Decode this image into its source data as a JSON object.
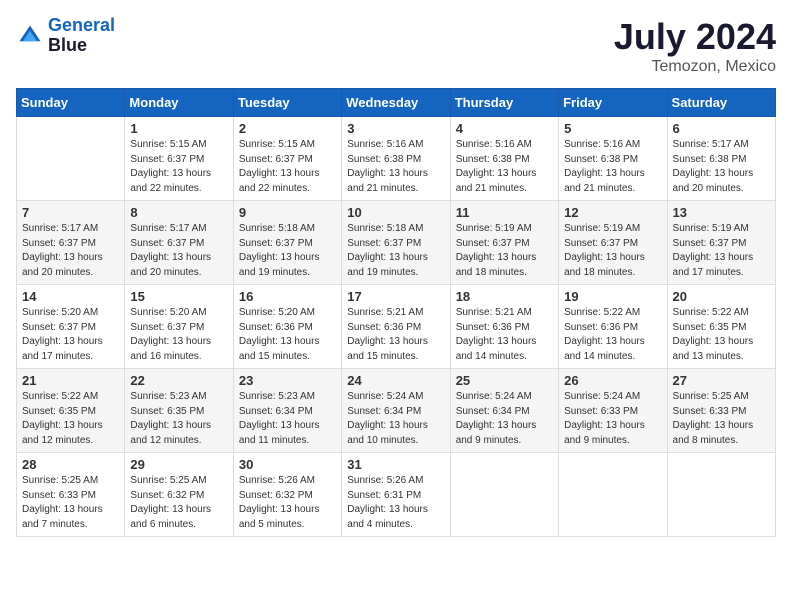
{
  "header": {
    "logo_line1": "General",
    "logo_line2": "Blue",
    "main_title": "July 2024",
    "subtitle": "Temozon, Mexico"
  },
  "weekdays": [
    "Sunday",
    "Monday",
    "Tuesday",
    "Wednesday",
    "Thursday",
    "Friday",
    "Saturday"
  ],
  "weeks": [
    [
      {
        "day": "",
        "sunrise": "",
        "sunset": "",
        "daylight": ""
      },
      {
        "day": "1",
        "sunrise": "Sunrise: 5:15 AM",
        "sunset": "Sunset: 6:37 PM",
        "daylight": "Daylight: 13 hours and 22 minutes."
      },
      {
        "day": "2",
        "sunrise": "Sunrise: 5:15 AM",
        "sunset": "Sunset: 6:37 PM",
        "daylight": "Daylight: 13 hours and 22 minutes."
      },
      {
        "day": "3",
        "sunrise": "Sunrise: 5:16 AM",
        "sunset": "Sunset: 6:38 PM",
        "daylight": "Daylight: 13 hours and 21 minutes."
      },
      {
        "day": "4",
        "sunrise": "Sunrise: 5:16 AM",
        "sunset": "Sunset: 6:38 PM",
        "daylight": "Daylight: 13 hours and 21 minutes."
      },
      {
        "day": "5",
        "sunrise": "Sunrise: 5:16 AM",
        "sunset": "Sunset: 6:38 PM",
        "daylight": "Daylight: 13 hours and 21 minutes."
      },
      {
        "day": "6",
        "sunrise": "Sunrise: 5:17 AM",
        "sunset": "Sunset: 6:38 PM",
        "daylight": "Daylight: 13 hours and 20 minutes."
      }
    ],
    [
      {
        "day": "7",
        "sunrise": "Sunrise: 5:17 AM",
        "sunset": "Sunset: 6:37 PM",
        "daylight": "Daylight: 13 hours and 20 minutes."
      },
      {
        "day": "8",
        "sunrise": "Sunrise: 5:17 AM",
        "sunset": "Sunset: 6:37 PM",
        "daylight": "Daylight: 13 hours and 20 minutes."
      },
      {
        "day": "9",
        "sunrise": "Sunrise: 5:18 AM",
        "sunset": "Sunset: 6:37 PM",
        "daylight": "Daylight: 13 hours and 19 minutes."
      },
      {
        "day": "10",
        "sunrise": "Sunrise: 5:18 AM",
        "sunset": "Sunset: 6:37 PM",
        "daylight": "Daylight: 13 hours and 19 minutes."
      },
      {
        "day": "11",
        "sunrise": "Sunrise: 5:19 AM",
        "sunset": "Sunset: 6:37 PM",
        "daylight": "Daylight: 13 hours and 18 minutes."
      },
      {
        "day": "12",
        "sunrise": "Sunrise: 5:19 AM",
        "sunset": "Sunset: 6:37 PM",
        "daylight": "Daylight: 13 hours and 18 minutes."
      },
      {
        "day": "13",
        "sunrise": "Sunrise: 5:19 AM",
        "sunset": "Sunset: 6:37 PM",
        "daylight": "Daylight: 13 hours and 17 minutes."
      }
    ],
    [
      {
        "day": "14",
        "sunrise": "Sunrise: 5:20 AM",
        "sunset": "Sunset: 6:37 PM",
        "daylight": "Daylight: 13 hours and 17 minutes."
      },
      {
        "day": "15",
        "sunrise": "Sunrise: 5:20 AM",
        "sunset": "Sunset: 6:37 PM",
        "daylight": "Daylight: 13 hours and 16 minutes."
      },
      {
        "day": "16",
        "sunrise": "Sunrise: 5:20 AM",
        "sunset": "Sunset: 6:36 PM",
        "daylight": "Daylight: 13 hours and 15 minutes."
      },
      {
        "day": "17",
        "sunrise": "Sunrise: 5:21 AM",
        "sunset": "Sunset: 6:36 PM",
        "daylight": "Daylight: 13 hours and 15 minutes."
      },
      {
        "day": "18",
        "sunrise": "Sunrise: 5:21 AM",
        "sunset": "Sunset: 6:36 PM",
        "daylight": "Daylight: 13 hours and 14 minutes."
      },
      {
        "day": "19",
        "sunrise": "Sunrise: 5:22 AM",
        "sunset": "Sunset: 6:36 PM",
        "daylight": "Daylight: 13 hours and 14 minutes."
      },
      {
        "day": "20",
        "sunrise": "Sunrise: 5:22 AM",
        "sunset": "Sunset: 6:35 PM",
        "daylight": "Daylight: 13 hours and 13 minutes."
      }
    ],
    [
      {
        "day": "21",
        "sunrise": "Sunrise: 5:22 AM",
        "sunset": "Sunset: 6:35 PM",
        "daylight": "Daylight: 13 hours and 12 minutes."
      },
      {
        "day": "22",
        "sunrise": "Sunrise: 5:23 AM",
        "sunset": "Sunset: 6:35 PM",
        "daylight": "Daylight: 13 hours and 12 minutes."
      },
      {
        "day": "23",
        "sunrise": "Sunrise: 5:23 AM",
        "sunset": "Sunset: 6:34 PM",
        "daylight": "Daylight: 13 hours and 11 minutes."
      },
      {
        "day": "24",
        "sunrise": "Sunrise: 5:24 AM",
        "sunset": "Sunset: 6:34 PM",
        "daylight": "Daylight: 13 hours and 10 minutes."
      },
      {
        "day": "25",
        "sunrise": "Sunrise: 5:24 AM",
        "sunset": "Sunset: 6:34 PM",
        "daylight": "Daylight: 13 hours and 9 minutes."
      },
      {
        "day": "26",
        "sunrise": "Sunrise: 5:24 AM",
        "sunset": "Sunset: 6:33 PM",
        "daylight": "Daylight: 13 hours and 9 minutes."
      },
      {
        "day": "27",
        "sunrise": "Sunrise: 5:25 AM",
        "sunset": "Sunset: 6:33 PM",
        "daylight": "Daylight: 13 hours and 8 minutes."
      }
    ],
    [
      {
        "day": "28",
        "sunrise": "Sunrise: 5:25 AM",
        "sunset": "Sunset: 6:33 PM",
        "daylight": "Daylight: 13 hours and 7 minutes."
      },
      {
        "day": "29",
        "sunrise": "Sunrise: 5:25 AM",
        "sunset": "Sunset: 6:32 PM",
        "daylight": "Daylight: 13 hours and 6 minutes."
      },
      {
        "day": "30",
        "sunrise": "Sunrise: 5:26 AM",
        "sunset": "Sunset: 6:32 PM",
        "daylight": "Daylight: 13 hours and 5 minutes."
      },
      {
        "day": "31",
        "sunrise": "Sunrise: 5:26 AM",
        "sunset": "Sunset: 6:31 PM",
        "daylight": "Daylight: 13 hours and 4 minutes."
      },
      {
        "day": "",
        "sunrise": "",
        "sunset": "",
        "daylight": ""
      },
      {
        "day": "",
        "sunrise": "",
        "sunset": "",
        "daylight": ""
      },
      {
        "day": "",
        "sunrise": "",
        "sunset": "",
        "daylight": ""
      }
    ]
  ]
}
